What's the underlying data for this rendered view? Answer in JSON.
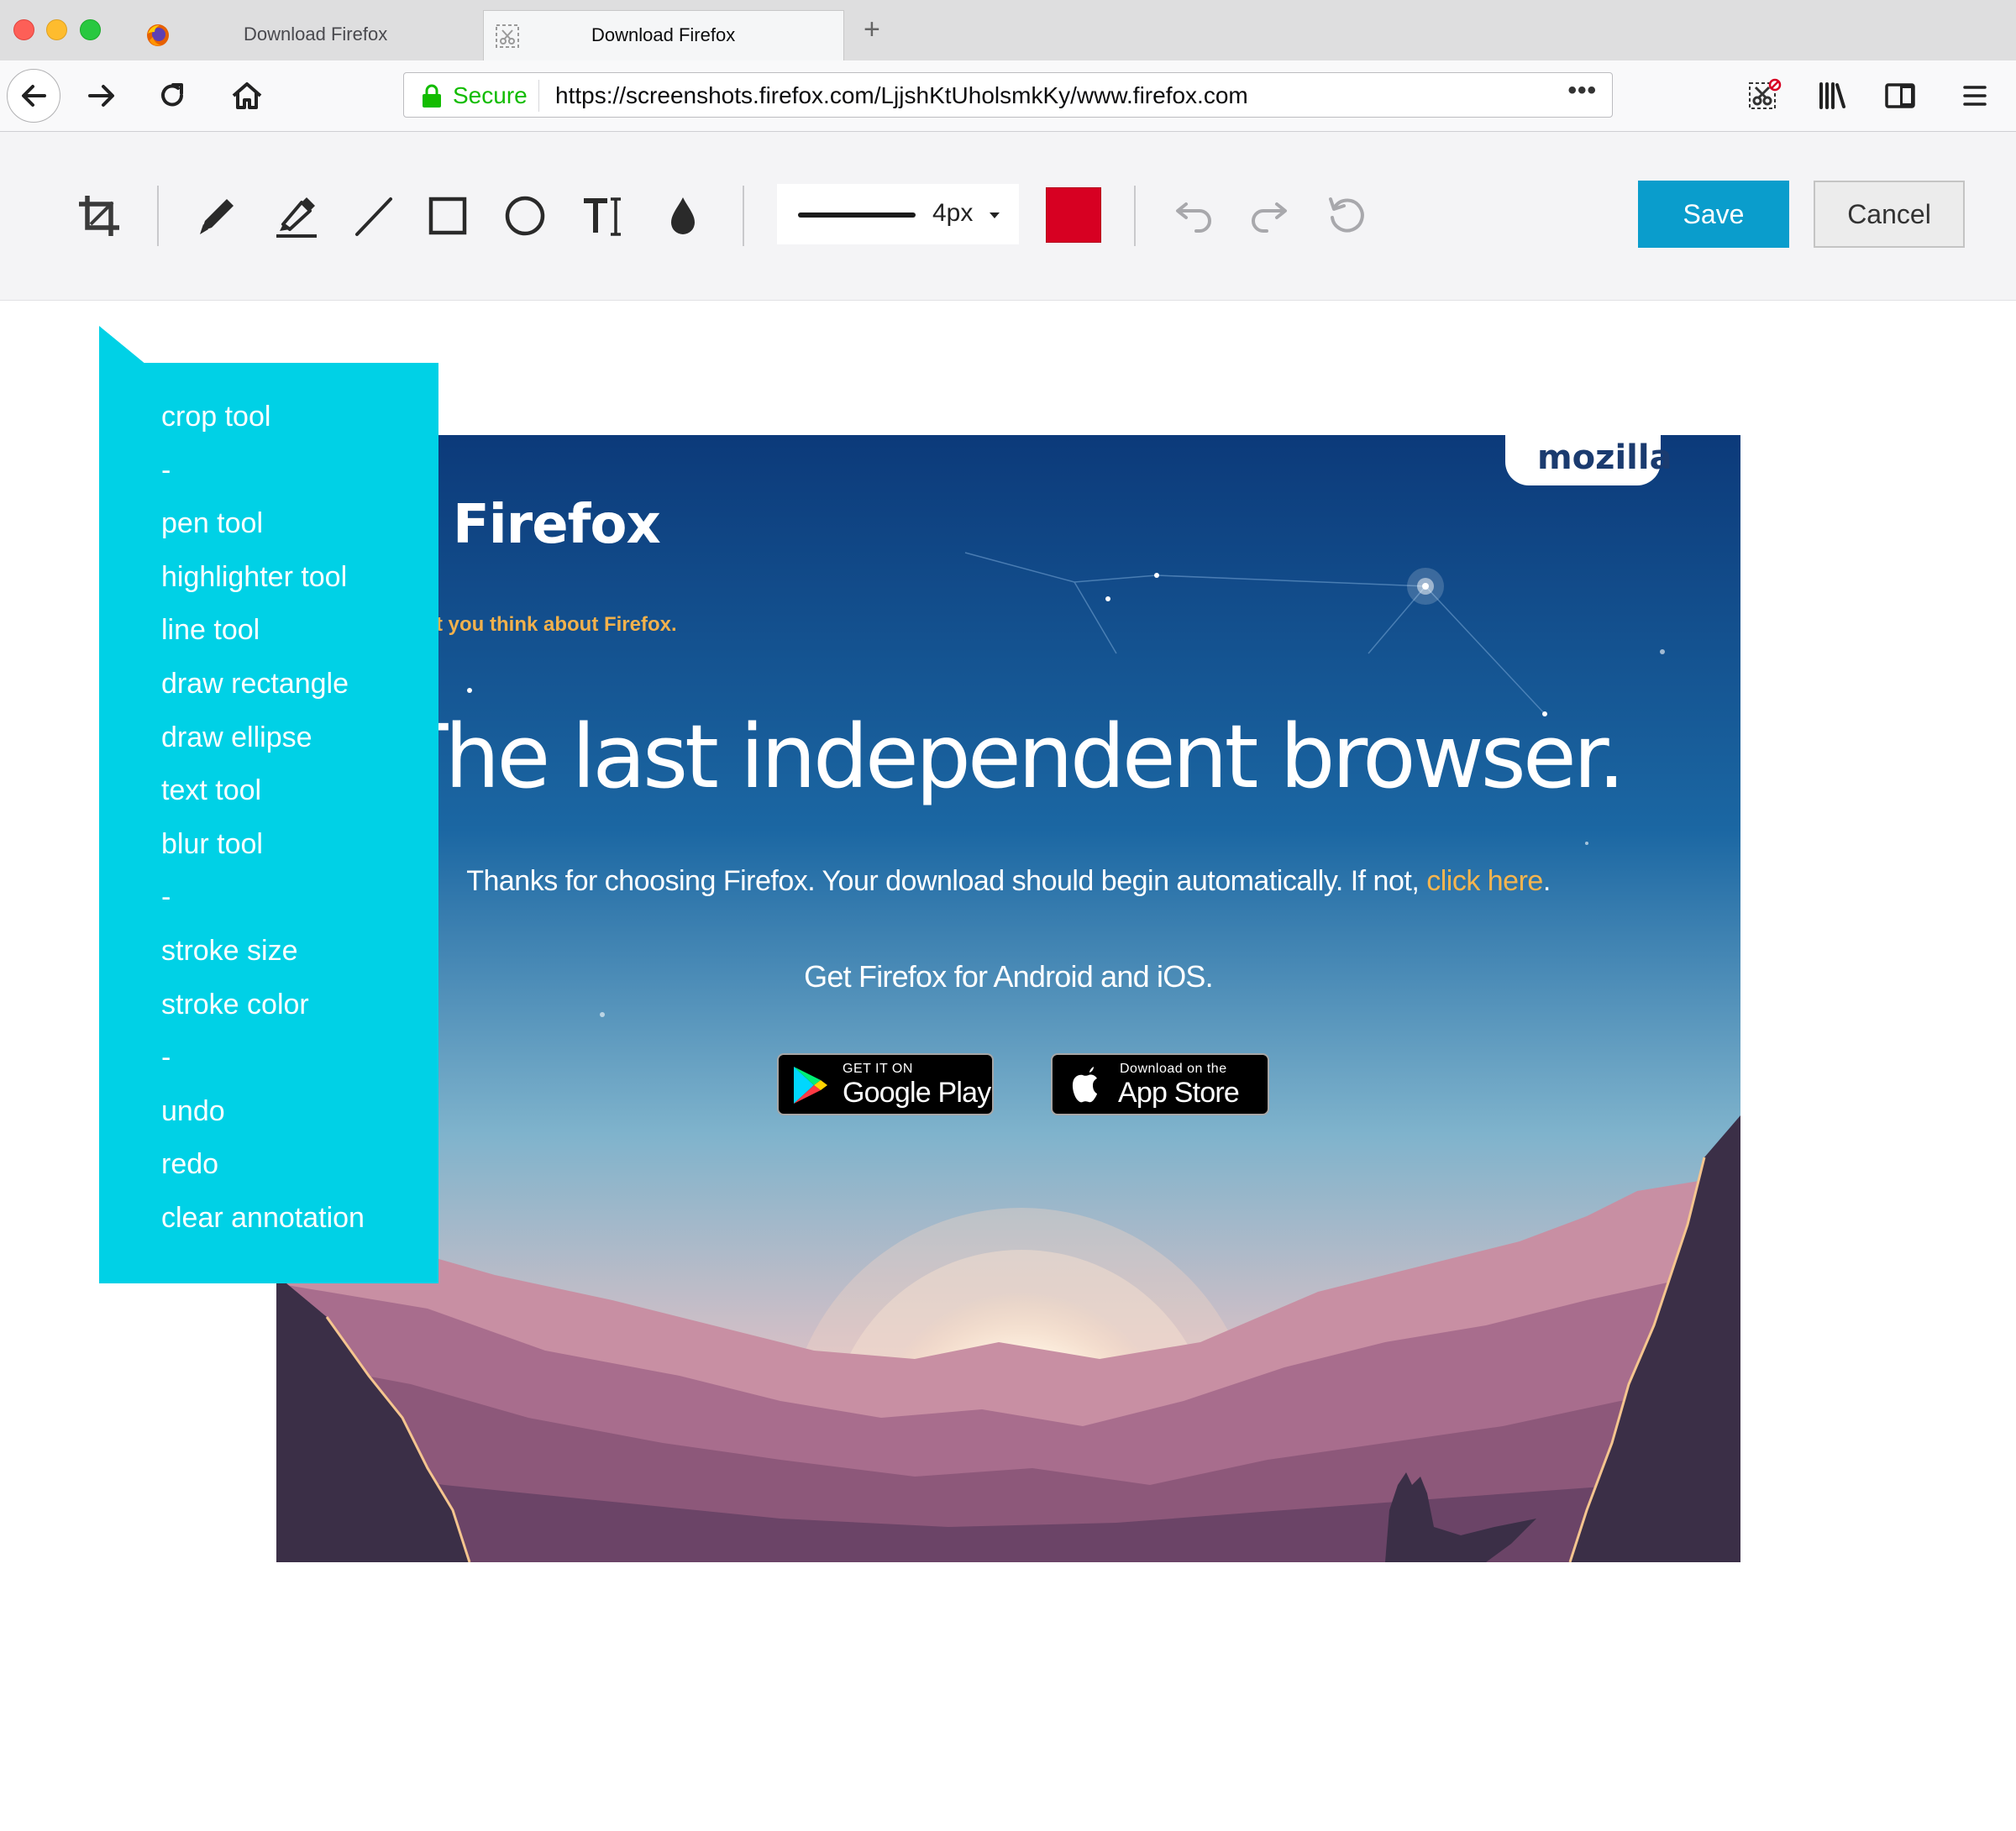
{
  "tabs": [
    {
      "title": "Download Firefox",
      "icon": "firefox-icon",
      "active": false
    },
    {
      "title": "Download Firefox",
      "icon": "screenshots-icon",
      "active": true
    }
  ],
  "navbar": {
    "security_label": "Secure",
    "url": "https://screenshots.firefox.com/LjjshKtUholsmkKy/www.firefox.com",
    "page_actions": "•••"
  },
  "toolbar": {
    "stroke_size": "4px",
    "stroke_color": "#d70022",
    "save_label": "Save",
    "cancel_label": "Cancel",
    "accent_color": "#0a9dcc"
  },
  "callout": {
    "items": [
      "crop tool",
      "-",
      "pen tool",
      "highlighter tool",
      "line tool",
      "draw rectangle",
      "draw ellipse",
      "text tool",
      "blur tool",
      "-",
      "stroke size",
      "stroke color",
      "-",
      "undo",
      "redo",
      "clear annotation"
    ],
    "color": "#00d1e6"
  },
  "screenshot": {
    "mozilla": "mozilla",
    "brand": "Firefox",
    "tagline": "t you think about Firefox.",
    "headline": "The last independent browser.",
    "thanks_prefix": "Thanks for choosing Firefox. Your download should begin automatically. If not, ",
    "thanks_link": "click here",
    "thanks_suffix": ".",
    "mobile": "Get Firefox for Android and iOS.",
    "google_small": "GET IT ON",
    "google_big": "Google Play",
    "apple_small": "Download on the",
    "apple_big": "App Store"
  }
}
